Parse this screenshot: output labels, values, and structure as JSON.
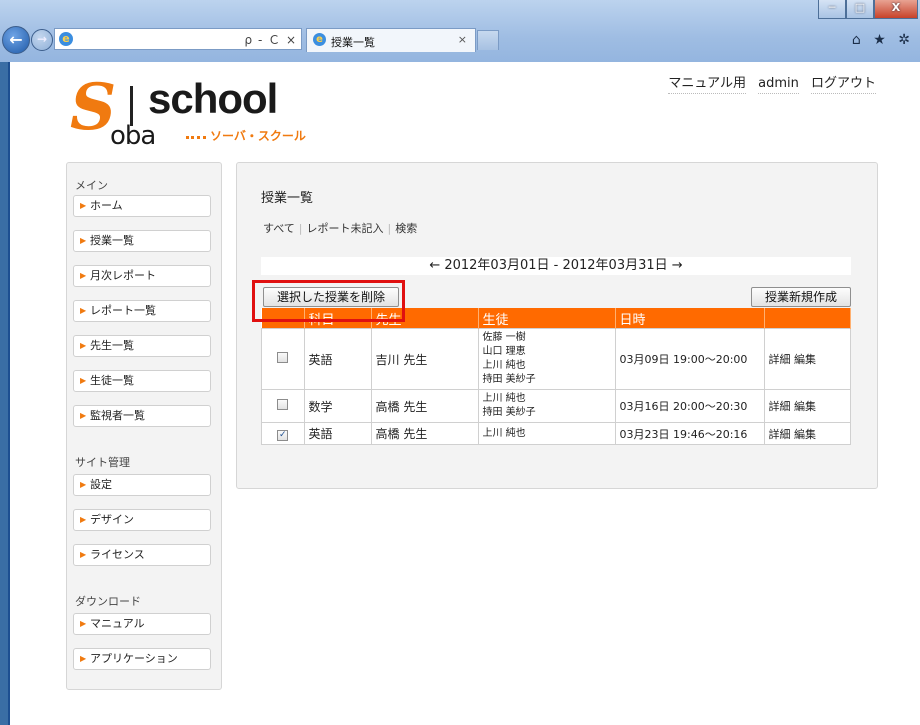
{
  "browser": {
    "tab_title": "授業一覧",
    "tab_close": "×",
    "address_controls": "ρ - Ｃ ×",
    "window_buttons": [
      "─",
      "□",
      "X"
    ],
    "tools": "⌂ ★ ✲",
    "back": "←",
    "forward": "→",
    "favicon": "e"
  },
  "logo": {
    "s": "S",
    "school": "school",
    "oba": "oba",
    "kana": "ソーバ・スクール"
  },
  "header": {
    "manual": "マニュアル用",
    "admin": "admin",
    "logout": "ログアウト"
  },
  "sidebar": {
    "sections": [
      {
        "title": "メイン",
        "items": [
          "ホーム",
          "授業一覧",
          "月次レポート",
          "レポート一覧",
          "先生一覧",
          "生徒一覧",
          "監視者一覧"
        ]
      },
      {
        "title": "サイト管理",
        "items": [
          "設定",
          "デザイン",
          "ライセンス"
        ]
      },
      {
        "title": "ダウンロード",
        "items": [
          "マニュアル",
          "アプリケーション"
        ]
      }
    ]
  },
  "main": {
    "title": "授業一覧",
    "filters": [
      "すべて",
      "レポート未記入",
      "検索"
    ],
    "date_range": "← 2012年03月01日 - 2012年03月31日 →",
    "delete_button": "選択した授業を削除",
    "new_button": "授業新規作成",
    "table": {
      "headers": [
        "",
        "科目",
        "先生",
        "生徒",
        "日時",
        ""
      ],
      "rows": [
        {
          "checked": false,
          "subject": "英語",
          "teacher": "吉川 先生",
          "students": [
            "佐藤 一樹",
            "山口 理恵",
            "上川 純也",
            "持田 美紗子"
          ],
          "time": "03月09日 19:00～20:00",
          "detail": "詳細",
          "edit": "編集"
        },
        {
          "checked": false,
          "subject": "数学",
          "teacher": "高橋 先生",
          "students": [
            "上川 純也",
            "持田 美紗子"
          ],
          "time": "03月16日 20:00～20:30",
          "detail": "詳細",
          "edit": "編集"
        },
        {
          "checked": true,
          "subject": "英語",
          "teacher": "高橋 先生",
          "students": [
            "上川 純也"
          ],
          "time": "03月23日 19:46～20:16",
          "detail": "詳細",
          "edit": "編集"
        }
      ]
    }
  },
  "colors": {
    "accent_orange": "#ff6a00",
    "highlight_red": "#e01010",
    "logo_orange": "#f07a10"
  }
}
